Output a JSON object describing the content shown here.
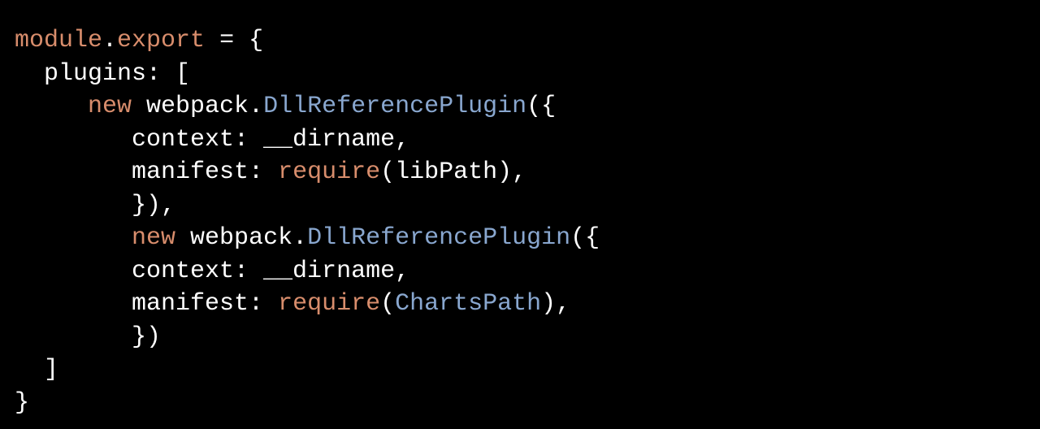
{
  "code": {
    "l1": {
      "t1": "module",
      "t2": ".",
      "t3": "export",
      "t4": " = {"
    },
    "l2": {
      "t1": "  plugins: ["
    },
    "l3": {
      "t1": "     ",
      "t2": "new",
      "t3": " webpack.",
      "t4": "DllReferencePlugin",
      "t5": "({"
    },
    "l4": {
      "t1": "        context: __dirname,"
    },
    "l5": {
      "t1": "        manifest: ",
      "t2": "require",
      "t3": "(libPath),"
    },
    "l6": {
      "t1": "        }),"
    },
    "l7": {
      "t1": "        ",
      "t2": "new",
      "t3": " webpack.",
      "t4": "DllReferencePlugin",
      "t5": "({"
    },
    "l8": {
      "t1": "        context: __dirname,"
    },
    "l9": {
      "t1": "        manifest: ",
      "t2": "require",
      "t3": "(",
      "t4": "ChartsPath",
      "t5": "),"
    },
    "l10": {
      "t1": "        })"
    },
    "l11": {
      "t1": "  ]"
    },
    "l12": {
      "t1": "}"
    }
  }
}
